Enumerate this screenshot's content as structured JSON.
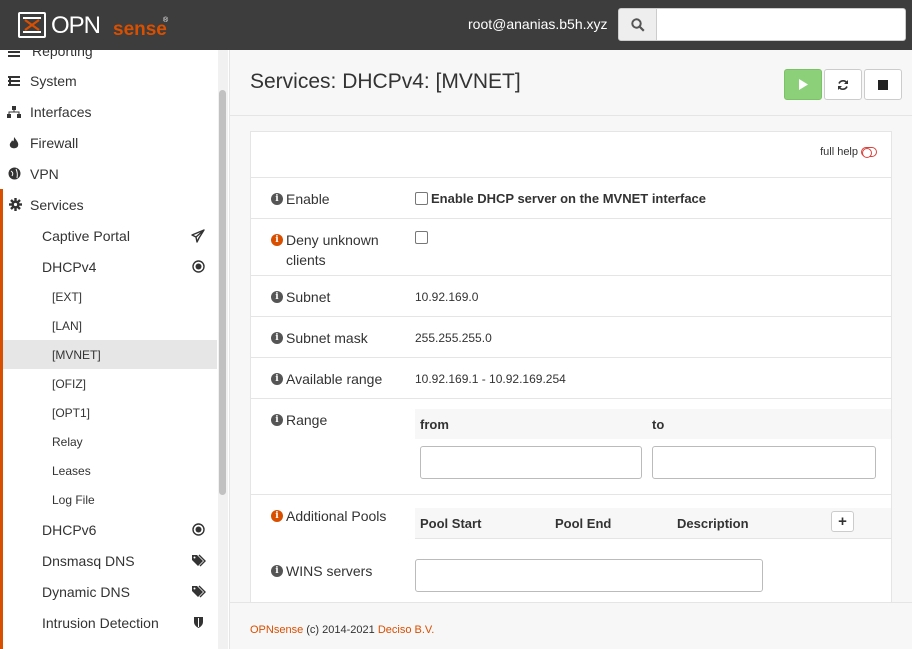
{
  "header": {
    "logo_text": "OPNsense",
    "user": "root@ananias.b5h.xyz",
    "search_placeholder": ""
  },
  "sidebar": {
    "top_items": [
      {
        "label": "Reporting",
        "icon": "reporting-icon"
      },
      {
        "label": "System",
        "icon": "system-icon"
      },
      {
        "label": "Interfaces",
        "icon": "interfaces-icon"
      },
      {
        "label": "Firewall",
        "icon": "fire-icon"
      },
      {
        "label": "VPN",
        "icon": "globe-icon"
      },
      {
        "label": "Services",
        "icon": "gear-icon"
      }
    ],
    "services": [
      {
        "label": "Captive Portal",
        "icon": "paper-plane-icon"
      },
      {
        "label": "DHCPv4",
        "icon": "bullseye-icon"
      },
      {
        "label": "DHCPv6",
        "icon": "bullseye-icon"
      },
      {
        "label": "Dnsmasq DNS",
        "icon": "tags-icon"
      },
      {
        "label": "Dynamic DNS",
        "icon": "tags-icon"
      },
      {
        "label": "Intrusion Detection",
        "icon": "shield-icon"
      }
    ],
    "dhcpv4_children": [
      "[EXT]",
      "[LAN]",
      "[MVNET]",
      "[OFIZ]",
      "[OPT1]",
      "Relay",
      "Leases",
      "Log File"
    ]
  },
  "page": {
    "title": "Services: DHCPv4: [MVNET]",
    "full_help": "full help"
  },
  "form": {
    "enable": {
      "label": "Enable",
      "checkbox_label": "Enable DHCP server on the MVNET interface"
    },
    "deny_unknown": {
      "label": "Deny unknown clients"
    },
    "subnet": {
      "label": "Subnet",
      "value": "10.92.169.0"
    },
    "subnet_mask": {
      "label": "Subnet mask",
      "value": "255.255.255.0"
    },
    "available_range": {
      "label": "Available range",
      "value": "10.92.169.1 - 10.92.169.254"
    },
    "range": {
      "label": "Range",
      "from": "from",
      "to": "to",
      "from_value": "",
      "to_value": ""
    },
    "additional_pools": {
      "label": "Additional Pools",
      "col_start": "Pool Start",
      "col_end": "Pool End",
      "col_desc": "Description",
      "add": "+"
    },
    "wins": {
      "label": "WINS servers",
      "value": ""
    }
  },
  "footer": {
    "brand": "OPNsense",
    "copyright": " (c) 2014-2021 ",
    "company": "Deciso B.V."
  },
  "colors": {
    "accent": "#d94f00",
    "topbar": "#3d3d3d",
    "start_button": "#8dd07a"
  }
}
